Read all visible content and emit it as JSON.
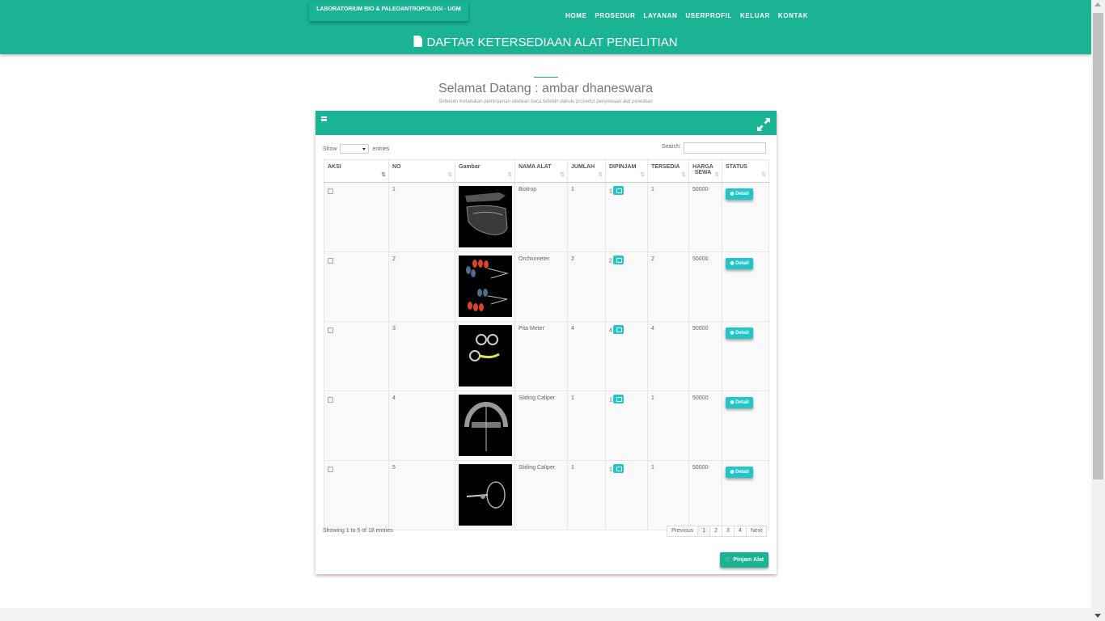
{
  "header": {
    "brand": "LABORATORIUM BIO & PALEOANTROPOLOGI - UGM",
    "nav": [
      "HOME",
      "PROSEDUR",
      "LAYANAN",
      "USERPROFIL",
      "KELUAR",
      "KONTAK"
    ],
    "page_title": "DAFTAR KETERSEDIAAN ALAT PENELITIAN",
    "accent_color": "#1ab394"
  },
  "welcome": {
    "title": "Selamat Datang : ambar dhaneswara",
    "subtitle": "Sebelum melakukan peminjaman silahkan baca terlebih dahulu prosedur penyewaan alat penelitian"
  },
  "table_controls": {
    "show_label": "Show",
    "entries_label": "entries",
    "search_label": "Search:"
  },
  "columns": [
    "AKSI",
    "NO",
    "Gambar",
    "NAMA ALAT",
    "JUMLAH",
    "DIPINJAM",
    "TERSEDIA",
    "HARGA SEWA",
    "STATUS"
  ],
  "rows": [
    {
      "no": "1",
      "nama": "Biotrop",
      "jumlah": "1",
      "dipinjam": "1",
      "tersedia": "1",
      "harga": "50000",
      "status": "Detail"
    },
    {
      "no": "2",
      "nama": "Orchiometer",
      "jumlah": "2",
      "dipinjam": "2",
      "tersedia": "2",
      "harga": "50000",
      "status": "Detail"
    },
    {
      "no": "3",
      "nama": "Pita Meter",
      "jumlah": "4",
      "dipinjam": "4",
      "tersedia": "4",
      "harga": "50000",
      "status": "Detail"
    },
    {
      "no": "4",
      "nama": "Sliding Caliper",
      "jumlah": "1",
      "dipinjam": "1",
      "tersedia": "1",
      "harga": "50000",
      "status": "Detail"
    },
    {
      "no": "5",
      "nama": "Sliding Caliper",
      "jumlah": "1",
      "dipinjam": "1",
      "tersedia": "1",
      "harga": "50000",
      "status": "Detail"
    }
  ],
  "footer": {
    "info": "Showing 1 to 5 of 18 entries",
    "pager": [
      "Previous",
      "1",
      "2",
      "3",
      "4",
      "Next"
    ],
    "pinjam_label": "Pinjam Alat"
  }
}
